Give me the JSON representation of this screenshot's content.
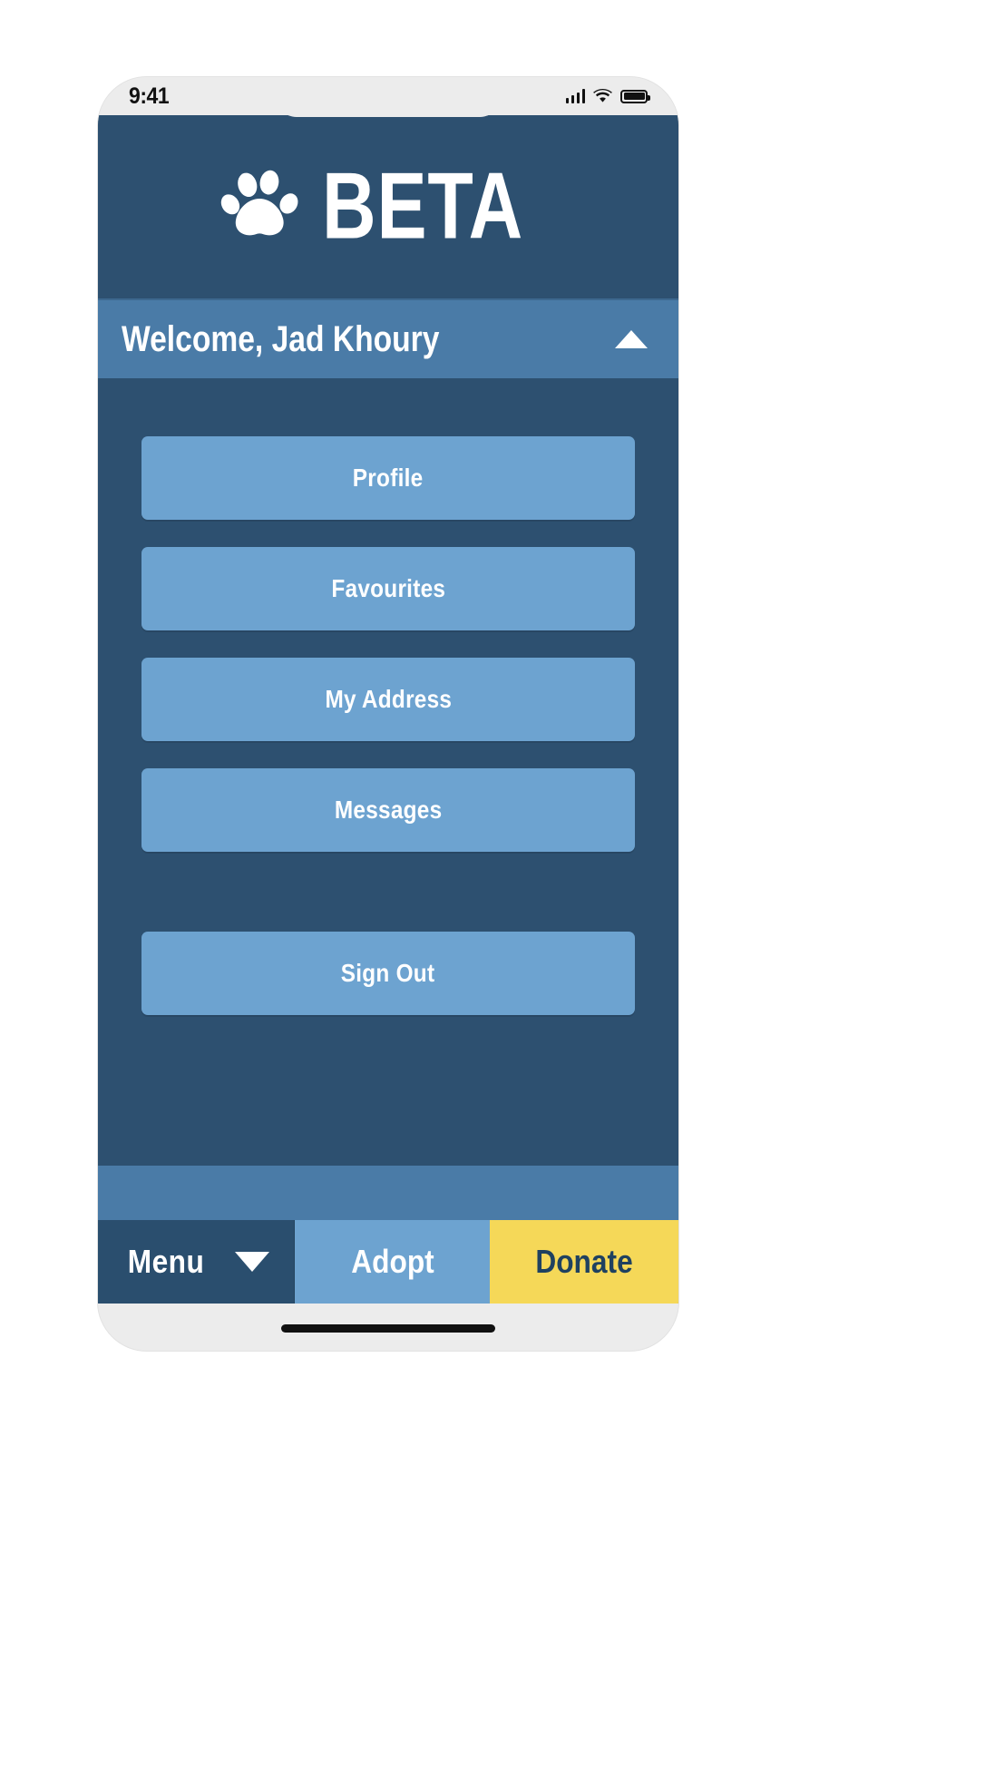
{
  "device": {
    "status_bar": {
      "time": "9:41",
      "signal_icon": "cellular-signal-icon",
      "wifi_icon": "wifi-icon",
      "battery_icon": "battery-icon"
    },
    "home_indicator": "home-indicator"
  },
  "header": {
    "logo_icon": "paw-print-icon",
    "brand": "BETA"
  },
  "welcome": {
    "greeting": "Welcome, Jad Khoury",
    "toggle_icon": "caret-up-icon"
  },
  "menu": {
    "items": [
      {
        "label": "Profile"
      },
      {
        "label": "Favourites"
      },
      {
        "label": "My Address"
      },
      {
        "label": "Messages"
      }
    ],
    "sign_out": {
      "label": "Sign Out"
    }
  },
  "bottom_nav": {
    "menu": {
      "label": "Menu",
      "icon": "caret-down-icon"
    },
    "adopt": {
      "label": "Adopt"
    },
    "donate": {
      "label": "Donate"
    }
  },
  "colors": {
    "header_dark_blue": "#2d5070",
    "welcome_blue": "#4a7ba7",
    "button_blue": "#6da3d0",
    "donate_yellow": "#f5d858",
    "donate_text": "#1f4160",
    "white": "#ffffff"
  }
}
